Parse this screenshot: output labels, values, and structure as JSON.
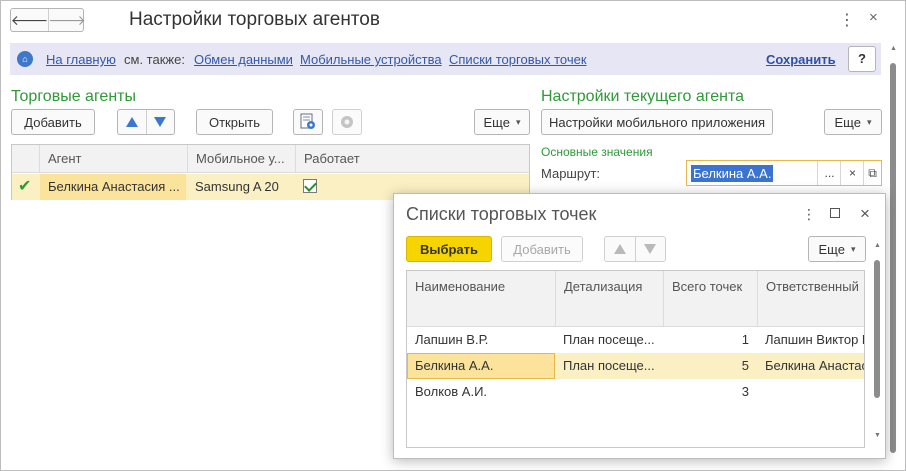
{
  "window": {
    "title": "Настройки торговых агентов",
    "back_icon": "arrow-left",
    "forward_icon": "arrow-right",
    "more_icon": "⋮",
    "close_icon": "×"
  },
  "command_bar": {
    "home_link": "На главную",
    "see_also_label": "см. также:",
    "links": [
      "Обмен данными",
      "Мобильные устройства",
      "Списки торговых точек"
    ],
    "save_label": "Сохранить",
    "help_label": "?"
  },
  "agents_panel": {
    "title": "Торговые агенты",
    "add_button": "Добавить",
    "open_button": "Открыть",
    "more_button": "Еще",
    "columns": [
      "Агент",
      "Мобильное у...",
      "Работает"
    ],
    "rows": [
      {
        "agent": "Белкина Анастасия ...",
        "device": "Samsung A 20",
        "active": true
      }
    ]
  },
  "current_agent_panel": {
    "title": "Настройки текущего агента",
    "mobile_settings_button": "Настройки мобильного приложения",
    "more_button": "Еще",
    "group_title": "Основные значения",
    "route_label": "Маршрут:",
    "route_value": "Белкина А.А.",
    "select_button": "...",
    "clear_button": "×",
    "open_button": "⧉"
  },
  "popup": {
    "title": "Списки торговых точек",
    "select_button": "Выбрать",
    "add_button": "Добавить",
    "more_button": "Еще",
    "columns": [
      "Наименование",
      "Детализация",
      "Всего точек",
      "Ответственный"
    ],
    "rows": [
      {
        "name": "Лапшин В.Р.",
        "detail": "План посеще...",
        "total": "1",
        "owner": "Лапшин Виктор Р"
      },
      {
        "name": "Белкина А.А.",
        "detail": "План посеще...",
        "total": "5",
        "owner": "Белкина Анастася"
      },
      {
        "name": "Волков А.И.",
        "detail": "",
        "total": "3",
        "owner": ""
      }
    ]
  },
  "colors": {
    "accent_green": "#2e9a38",
    "selection_yellow": "#fbf0c4",
    "link_blue": "#3358a6",
    "primary_button": "#f6d400"
  }
}
